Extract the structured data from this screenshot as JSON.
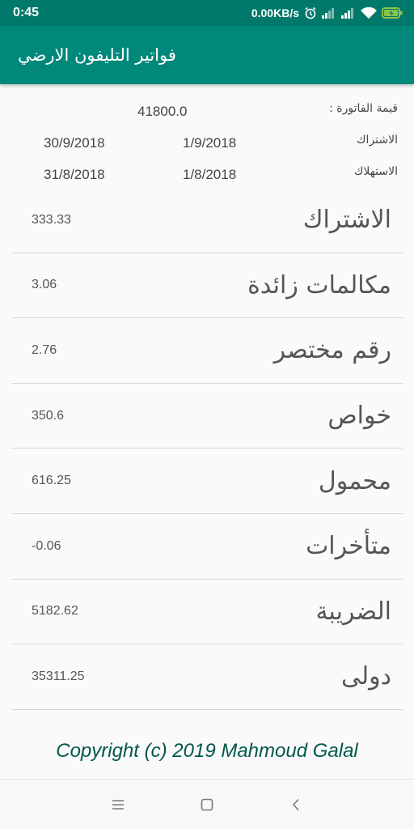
{
  "status_bar": {
    "time": "0:45",
    "net_speed": "0.00KB/s",
    "icons": [
      "alarm-icon",
      "signal-icon",
      "signal-icon",
      "wifi-icon",
      "battery-charging-icon"
    ]
  },
  "app_bar": {
    "title": "فواتير التليفون الارضي"
  },
  "summary": {
    "invoice_label": "قيمة الفاتورة :",
    "invoice_value": "41800.0",
    "subscription_label": "الاشتراك",
    "subscription_from": "1/9/2018",
    "subscription_to": "30/9/2018",
    "consumption_label": "الاستهلاك",
    "consumption_from": "1/8/2018",
    "consumption_to": "31/8/2018"
  },
  "items": [
    {
      "label": "الاشتراك",
      "value": "333.33"
    },
    {
      "label": "مكالمات زائدة",
      "value": "3.06"
    },
    {
      "label": "رقم مختصر",
      "value": "2.76"
    },
    {
      "label": "خواص",
      "value": "350.6"
    },
    {
      "label": "محمول",
      "value": "616.25"
    },
    {
      "label": "متأخرات",
      "value": "-0.06"
    },
    {
      "label": "الضريبة",
      "value": "5182.62"
    },
    {
      "label": "دولى",
      "value": "35311.25"
    }
  ],
  "footer": {
    "copyright": "Copyright (c) 2019 Mahmoud Galal"
  },
  "nav_bar": {
    "icons": [
      "menu-icon",
      "home-icon",
      "back-icon"
    ]
  },
  "colors": {
    "status_bar": "#00796b",
    "app_bar": "#00897b",
    "copyright": "#00574b",
    "background": "#fafafa"
  }
}
